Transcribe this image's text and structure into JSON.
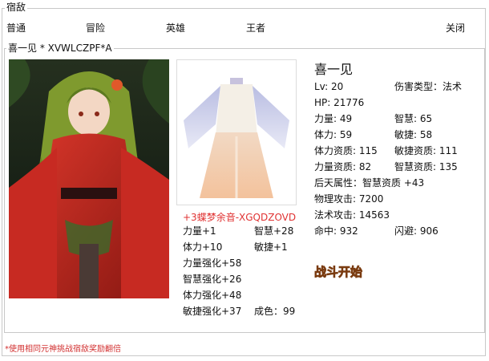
{
  "window": {
    "title": "宿敌"
  },
  "tabs": [
    {
      "label": "普通"
    },
    {
      "label": "冒险"
    },
    {
      "label": "英雄"
    },
    {
      "label": "王者"
    },
    {
      "label": "关闭"
    }
  ],
  "panel": {
    "legend": "喜一见  *  XVWLCZPF*A"
  },
  "item": {
    "name": "+3蝶梦余音-XGQDZOVD",
    "stats": [
      "力量+1",
      "智慧+28",
      "体力+10",
      "敏捷+1",
      "力量强化+58",
      "智慧强化+26",
      "体力强化+48",
      "敏捷强化+37",
      "成色：99"
    ]
  },
  "character": {
    "name": "喜一见",
    "stats": [
      "Lv: 20",
      "伤害类型：法术",
      "HP: 21776",
      "力量: 49",
      "智慧: 65",
      "体力: 59",
      "敏捷: 58",
      "体力资质: 115",
      "敏捷资质: 111",
      "力量资质: 82",
      "智慧资质: 135",
      "后天属性：智慧资质 +43",
      "物理攻击: 7200",
      "法术攻击: 14563",
      "命中: 932",
      "闪避: 906"
    ]
  },
  "actions": {
    "battle_label": "战斗开始"
  },
  "footer": {
    "note": "*使用相同元神挑战宿敌奖励翻倍"
  },
  "colors": {
    "red_text": "#e03333",
    "border": "#c8c8c8",
    "battle_gold": "#f2c04a"
  }
}
